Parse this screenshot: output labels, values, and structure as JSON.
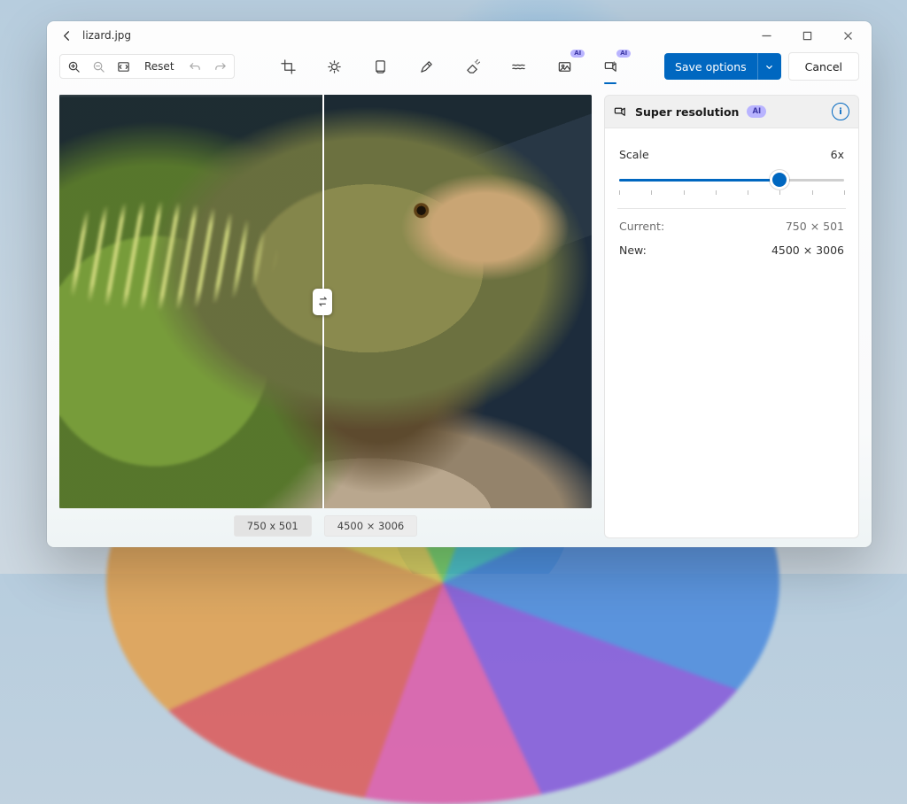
{
  "title": "lizard.jpg",
  "toolbar": {
    "reset_label": "Reset",
    "save_label": "Save options",
    "cancel_label": "Cancel",
    "ai_badge": "AI"
  },
  "tools": {
    "crop": "crop",
    "adjust": "adjustment",
    "filter": "filter",
    "markup": "markup",
    "erase": "erase",
    "retouch": "retouch",
    "bg_ai": "background-remove",
    "superres_ai": "super-resolution"
  },
  "compare": {
    "left_label": "750 x 501",
    "right_label": "4500 × 3006",
    "divider_pct": 49.5
  },
  "panel": {
    "title": "Super resolution",
    "ai_badge": "AI",
    "scale_label": "Scale",
    "scale_value": "6x",
    "scale_numeric": 6,
    "scale_min": 1,
    "scale_max": 8,
    "current_label": "Current:",
    "current_value": "750 × 501",
    "new_label": "New:",
    "new_value": "4500 × 3006"
  },
  "colors": {
    "accent": "#0067c0"
  }
}
